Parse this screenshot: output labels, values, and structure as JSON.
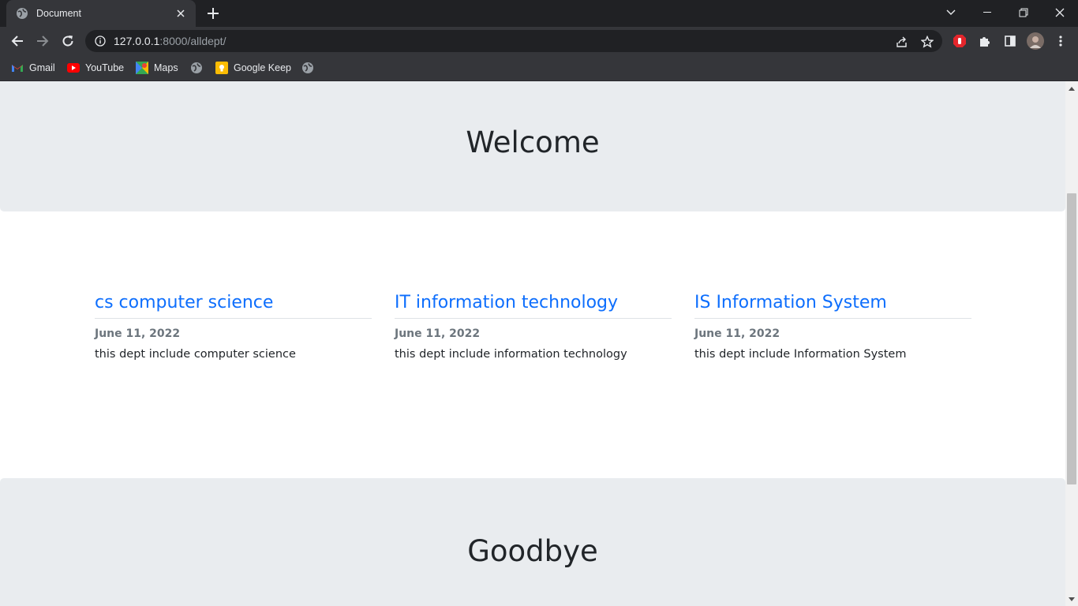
{
  "browser": {
    "tab_title": "Document",
    "url_host": "127.0.0.1",
    "url_rest": ":8000/alldept/",
    "colors": {
      "titlebar": "#202124",
      "toolbar": "#35363a"
    }
  },
  "bookmarks": [
    {
      "label": "Gmail",
      "icon": "gmail-icon"
    },
    {
      "label": "YouTube",
      "icon": "youtube-icon"
    },
    {
      "label": "Maps",
      "icon": "maps-icon"
    },
    {
      "label": "",
      "icon": "globe-icon"
    },
    {
      "label": "Google Keep",
      "icon": "keep-icon"
    },
    {
      "label": "",
      "icon": "globe-icon"
    }
  ],
  "page": {
    "header_title": "Welcome",
    "footer_title": "Goodbye",
    "departments": [
      {
        "title": "cs computer science",
        "date": "June 11, 2022",
        "description": "this dept include computer science"
      },
      {
        "title": "IT information technology",
        "date": "June 11, 2022",
        "description": "this dept include information technology"
      },
      {
        "title": "IS Information System",
        "date": "June 11, 2022",
        "description": "this dept include Information System"
      }
    ],
    "colors": {
      "link": "#0d6efd",
      "jumbotron": "#e9ecef",
      "muted": "#6c757d"
    }
  }
}
